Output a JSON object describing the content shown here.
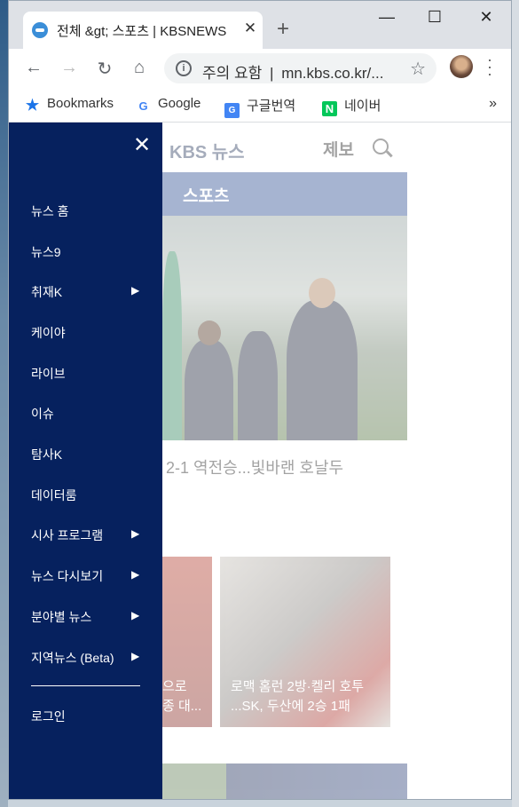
{
  "browser": {
    "tab_title": "전체 &gt; 스포츠 | KBSNEWS",
    "tab_close": "✕",
    "new_tab": "+",
    "window_controls": {
      "minimize": "—",
      "maximize": "☐",
      "close": "✕"
    },
    "nav": {
      "back": "←",
      "forward": "→",
      "reload": "↻",
      "home": "⌂"
    },
    "omnibox": {
      "security_label": "주의 요함",
      "separator": "|",
      "url": "mn.kbs.co.kr/...",
      "info": "i",
      "star": "☆"
    }
  },
  "bookmarks": {
    "items": [
      {
        "label": "Bookmarks",
        "icon": "bookmark-star-icon",
        "color": "#1a73e8"
      },
      {
        "label": "Google",
        "icon": "google-icon",
        "color": "#4285f4"
      },
      {
        "label": "구글번역",
        "icon": "google-translate-icon",
        "color": "#4285f4"
      },
      {
        "label": "네이버",
        "icon": "naver-icon",
        "color": "#03c75a"
      }
    ],
    "more": "»"
  },
  "site": {
    "logo": "KBS 뉴스",
    "report": "제보",
    "category": "스포츠",
    "headline": "2-1 역전승...빛바랜 호날두",
    "thumb_left_caption": [
      "으로",
      "종 대..."
    ],
    "thumb_right_caption": [
      "로맥 홈런 2방·켈리 호투",
      "...SK, 두산에 2승 1패"
    ],
    "colors": {
      "drawer_bg": "#06215e",
      "category_band": "#3b5a9a"
    }
  },
  "drawer": {
    "close": "✕",
    "items": [
      {
        "label": "뉴스 홈",
        "has_submenu": false
      },
      {
        "label": "뉴스9",
        "has_submenu": false
      },
      {
        "label": "취재K",
        "has_submenu": true
      },
      {
        "label": "케이야",
        "has_submenu": false
      },
      {
        "label": "라이브",
        "has_submenu": false
      },
      {
        "label": "이슈",
        "has_submenu": false
      },
      {
        "label": "탐사K",
        "has_submenu": false
      },
      {
        "label": "데이터룸",
        "has_submenu": false
      },
      {
        "label": "시사 프로그램",
        "has_submenu": true
      },
      {
        "label": "뉴스 다시보기",
        "has_submenu": true
      },
      {
        "label": "분야별 뉴스",
        "has_submenu": true
      },
      {
        "label": "지역뉴스 (Beta)",
        "has_submenu": true
      }
    ],
    "submenu_arrow": "▶",
    "login": "로그인"
  }
}
